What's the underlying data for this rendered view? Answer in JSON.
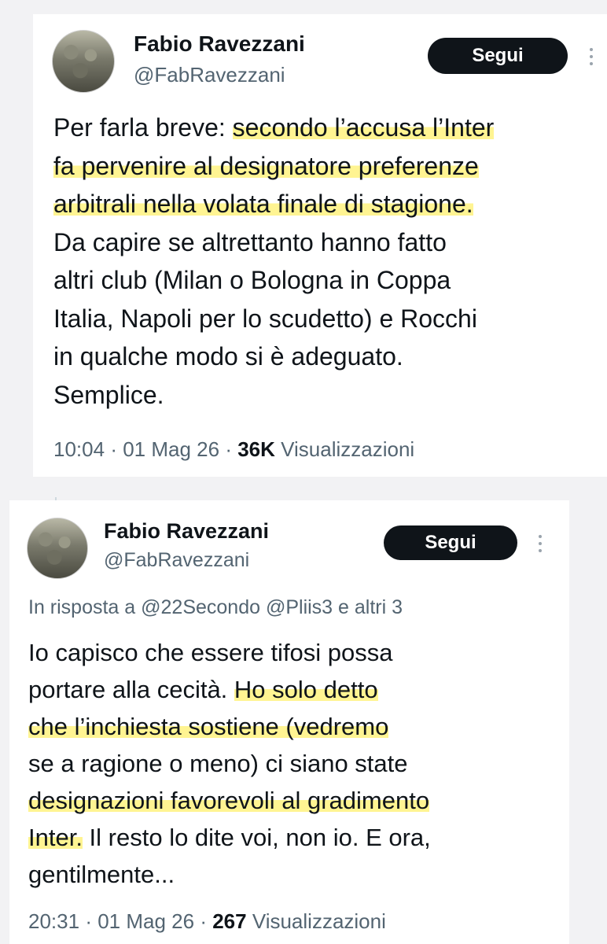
{
  "tweet1": {
    "author_name": "Fabio Ravezzani",
    "handle": "@FabRavezzani",
    "follow_label": "Segui",
    "lines": [
      {
        "plain": "Per farla breve: ",
        "hl": "secondo l’accusa l’Inter",
        "after": ""
      },
      {
        "plain": "",
        "hl": "fa pervenire al designatore preferenze",
        "after": ""
      },
      {
        "plain": "",
        "hl": "arbitrali nella volata finale di stagione.",
        "after": ""
      },
      {
        "plain": "Da capire se altrettanto hanno fatto",
        "hl": "",
        "after": ""
      },
      {
        "plain": "altri club (Milan o Bologna in Coppa",
        "hl": "",
        "after": ""
      },
      {
        "plain": "Italia, Napoli per lo scudetto) e Rocchi",
        "hl": "",
        "after": ""
      },
      {
        "plain": "in qualche modo si è adeguato.",
        "hl": "",
        "after": ""
      },
      {
        "plain": "Semplice.",
        "hl": "",
        "after": ""
      }
    ],
    "time": "10:04",
    "date": "01 Mag 26",
    "views_count": "36K",
    "views_label": "Visualizzazioni"
  },
  "tweet2": {
    "author_name": "Fabio Ravezzani",
    "handle": "@FabRavezzani",
    "follow_label": "Segui",
    "reply_prefix": "In risposta a",
    "reply_mentions": "@22Secondo @Pliis3",
    "reply_suffix": "e altri 3",
    "lines": [
      {
        "plain": "Io capisco che essere tifosi possa",
        "hl": "",
        "after": ""
      },
      {
        "plain": "portare alla cecità. ",
        "hl": "Ho solo detto",
        "after": ""
      },
      {
        "plain": "",
        "hl": "che l’inchiesta sostiene (vedremo",
        "after": ""
      },
      {
        "plain": "se a ragione o meno) ci siano state",
        "hl": "",
        "after": ""
      },
      {
        "plain": "",
        "hl": "designazioni favorevoli al gradimento",
        "after": ""
      },
      {
        "plain": "",
        "hl": "Inter.",
        "after": " Il resto lo dite voi, non io. E ora,"
      },
      {
        "plain": "gentilmente...",
        "hl": "",
        "after": ""
      }
    ],
    "time": "20:31",
    "date": "01 Mag 26",
    "views_count": "267",
    "views_label": "Visualizzazioni"
  }
}
